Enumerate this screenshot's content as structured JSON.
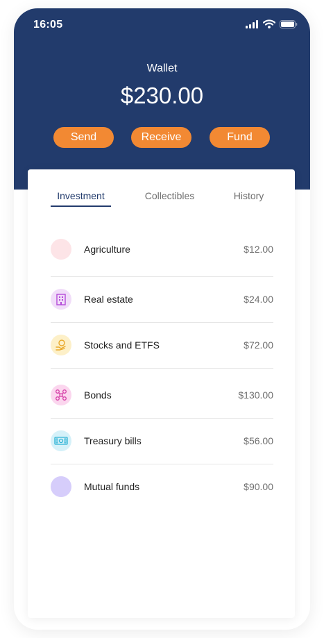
{
  "status_bar": {
    "time": "16:05"
  },
  "wallet": {
    "title": "Wallet",
    "balance": "$230.00"
  },
  "actions": {
    "send": "Send",
    "receive": "Receive",
    "fund": "Fund"
  },
  "tabs": [
    "Investment",
    "Collectibles",
    "History"
  ],
  "active_tab": "Investment",
  "investments": [
    {
      "label": "Agriculture",
      "value": "$12.00",
      "icon": "agriculture-icon",
      "bg": "#fde4e7"
    },
    {
      "label": "Real estate",
      "value": "$24.00",
      "icon": "building-icon",
      "bg": "#f1ddf9"
    },
    {
      "label": "Stocks and ETFS",
      "value": "$72.00",
      "icon": "money-hand-icon",
      "bg": "#fdf0c8"
    },
    {
      "label": "Bonds",
      "value": "$130.00",
      "icon": "network-icon",
      "bg": "#fbd6ee"
    },
    {
      "label": "Treasury bills",
      "value": "$56.00",
      "icon": "banknote-icon",
      "bg": "#d5f1f9"
    },
    {
      "label": "Mutual funds",
      "value": "$90.00",
      "icon": "mutual-funds-icon",
      "bg": "#d6cdfb"
    }
  ],
  "colors": {
    "header": "#223b6c",
    "accent": "#f28933",
    "text_primary": "#1f1f1f",
    "text_secondary": "#6f6f6f"
  }
}
